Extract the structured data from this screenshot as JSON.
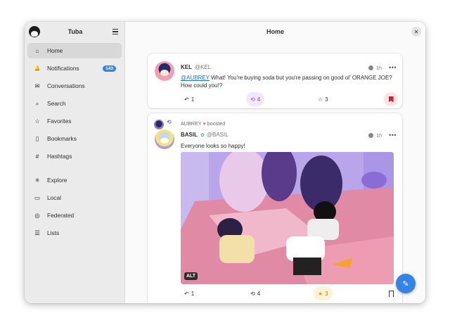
{
  "sidebar": {
    "title": "Tuba",
    "items": [
      {
        "icon": "home-icon",
        "glyph": "⌂",
        "label": "Home",
        "active": true,
        "badge": ""
      },
      {
        "icon": "bell-icon",
        "glyph": "🔔",
        "label": "Notifications",
        "active": false,
        "badge": "143"
      },
      {
        "icon": "envelope-icon",
        "glyph": "✉",
        "label": "Conversations",
        "active": false,
        "badge": ""
      },
      {
        "icon": "search-icon",
        "glyph": "⌕",
        "label": "Search",
        "active": false,
        "badge": ""
      },
      {
        "icon": "star-icon",
        "glyph": "☆",
        "label": "Favorites",
        "active": false,
        "badge": ""
      },
      {
        "icon": "bookmark-icon",
        "glyph": "▯",
        "label": "Bookmarks",
        "active": false,
        "badge": ""
      },
      {
        "icon": "hashtag-icon",
        "glyph": "#",
        "label": "Hashtags",
        "active": false,
        "badge": ""
      },
      {
        "icon": "explore-icon",
        "glyph": "✳",
        "label": "Explore",
        "active": false,
        "badge": ""
      },
      {
        "icon": "local-icon",
        "glyph": "▭",
        "label": "Local",
        "active": false,
        "badge": ""
      },
      {
        "icon": "globe-icon",
        "glyph": "◎",
        "label": "Federated",
        "active": false,
        "badge": ""
      },
      {
        "icon": "list-icon",
        "glyph": "☰",
        "label": "Lists",
        "active": false,
        "badge": ""
      }
    ]
  },
  "main": {
    "title": "Home"
  },
  "posts": [
    {
      "display_name": "KEL",
      "handle": "@KEL",
      "time": "1h",
      "mention": "@AUBREY",
      "text": " What! You're buying soda but you're passing on good ol' ORANGE JOE? How could you!?",
      "replies": "1",
      "boosts": "4",
      "favorites": "3"
    },
    {
      "boosted_by": "AUBREY",
      "boosted_label": "boosted",
      "display_name": "BASIL",
      "handle": "@BASIL",
      "time": "1h",
      "text": "Everyone looks so happy!",
      "alt_badge": "ALT",
      "replies": "1",
      "boosts": "4",
      "favorites": "3"
    }
  ],
  "colors": {
    "accent": "#3584e4",
    "boost": "#8a3fd1",
    "favorite": "#e5a50a",
    "bookmark": "#e01b24"
  }
}
